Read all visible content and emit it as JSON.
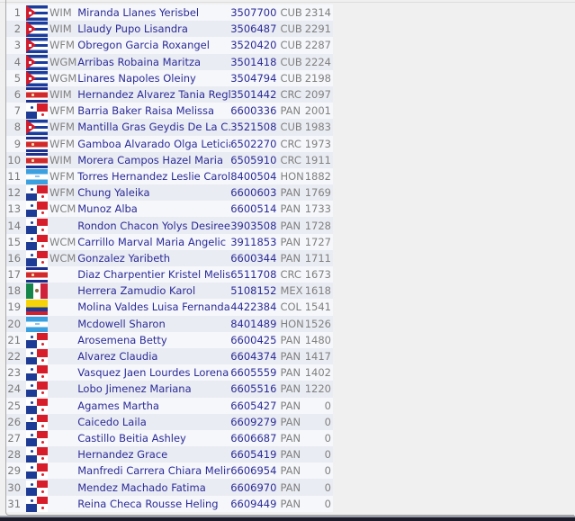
{
  "players": [
    {
      "rank": "1",
      "flag": "CUB",
      "title": "WIM",
      "name": "Miranda Llanes Yerisbel",
      "fide_id": "3507700",
      "fed": "CUB",
      "rating": "2314"
    },
    {
      "rank": "2",
      "flag": "CUB",
      "title": "WIM",
      "name": "Llaudy Pupo Lisandra",
      "fide_id": "3506487",
      "fed": "CUB",
      "rating": "2291"
    },
    {
      "rank": "3",
      "flag": "CUB",
      "title": "WFM",
      "name": "Obregon Garcia Roxangel",
      "fide_id": "3520420",
      "fed": "CUB",
      "rating": "2287"
    },
    {
      "rank": "4",
      "flag": "CUB",
      "title": "WGM",
      "name": "Arribas Robaina Maritza",
      "fide_id": "3501418",
      "fed": "CUB",
      "rating": "2224"
    },
    {
      "rank": "5",
      "flag": "CUB",
      "title": "WGM",
      "name": "Linares Napoles Oleiny",
      "fide_id": "3504794",
      "fed": "CUB",
      "rating": "2198"
    },
    {
      "rank": "6",
      "flag": "CRC",
      "title": "WIM",
      "name": "Hernandez Alvarez Tania Regla",
      "fide_id": "3501442",
      "fed": "CRC",
      "rating": "2097"
    },
    {
      "rank": "7",
      "flag": "PAN",
      "title": "WFM",
      "name": "Barria Baker Raisa Melissa",
      "fide_id": "6600336",
      "fed": "PAN",
      "rating": "2001"
    },
    {
      "rank": "8",
      "flag": "CUB",
      "title": "WFM",
      "name": "Mantilla Gras Geydis De La C.",
      "fide_id": "3521508",
      "fed": "CUB",
      "rating": "1983"
    },
    {
      "rank": "9",
      "flag": "CRC",
      "title": "WFM",
      "name": "Gamboa Alvarado Olga Leticia",
      "fide_id": "6502270",
      "fed": "CRC",
      "rating": "1973"
    },
    {
      "rank": "10",
      "flag": "CRC",
      "title": "WIM",
      "name": "Morera Campos Hazel Maria",
      "fide_id": "6505910",
      "fed": "CRC",
      "rating": "1911"
    },
    {
      "rank": "11",
      "flag": "HON",
      "title": "WFM",
      "name": "Torres Hernandez Leslie Carolin",
      "fide_id": "8400504",
      "fed": "HON",
      "rating": "1882"
    },
    {
      "rank": "12",
      "flag": "PAN",
      "title": "WFM",
      "name": "Chung Yaleika",
      "fide_id": "6600603",
      "fed": "PAN",
      "rating": "1769"
    },
    {
      "rank": "13",
      "flag": "PAN",
      "title": "WCM",
      "name": "Munoz Alba",
      "fide_id": "6600514",
      "fed": "PAN",
      "rating": "1733"
    },
    {
      "rank": "14",
      "flag": "PAN",
      "title": "",
      "name": "Rondon Chacon Yolys Desiree",
      "fide_id": "3903508",
      "fed": "PAN",
      "rating": "1728"
    },
    {
      "rank": "15",
      "flag": "PAN",
      "title": "WCM",
      "name": "Carrillo Marval Maria Angelic",
      "fide_id": "3911853",
      "fed": "PAN",
      "rating": "1727"
    },
    {
      "rank": "16",
      "flag": "PAN",
      "title": "WCM",
      "name": "Gonzalez Yaribeth",
      "fide_id": "6600344",
      "fed": "PAN",
      "rating": "1711"
    },
    {
      "rank": "17",
      "flag": "CRC",
      "title": "",
      "name": "Diaz Charpentier Kristel Meliss",
      "fide_id": "6511708",
      "fed": "CRC",
      "rating": "1673"
    },
    {
      "rank": "18",
      "flag": "MEX",
      "title": "",
      "name": "Herrera Zamudio Karol",
      "fide_id": "5108152",
      "fed": "MEX",
      "rating": "1618"
    },
    {
      "rank": "19",
      "flag": "COL",
      "title": "",
      "name": "Molina Valdes Luisa Fernanda",
      "fide_id": "4422384",
      "fed": "COL",
      "rating": "1541"
    },
    {
      "rank": "20",
      "flag": "HON",
      "title": "",
      "name": "Mcdowell Sharon",
      "fide_id": "8401489",
      "fed": "HON",
      "rating": "1526"
    },
    {
      "rank": "21",
      "flag": "PAN",
      "title": "",
      "name": "Arosemena Betty",
      "fide_id": "6600425",
      "fed": "PAN",
      "rating": "1480"
    },
    {
      "rank": "22",
      "flag": "PAN",
      "title": "",
      "name": "Alvarez Claudia",
      "fide_id": "6604374",
      "fed": "PAN",
      "rating": "1417"
    },
    {
      "rank": "23",
      "flag": "PAN",
      "title": "",
      "name": "Vasquez Jaen Lourdes Lorena",
      "fide_id": "6605559",
      "fed": "PAN",
      "rating": "1402"
    },
    {
      "rank": "24",
      "flag": "PAN",
      "title": "",
      "name": "Lobo Jimenez Mariana",
      "fide_id": "6605516",
      "fed": "PAN",
      "rating": "1220"
    },
    {
      "rank": "25",
      "flag": "PAN",
      "title": "",
      "name": "Agames Martha",
      "fide_id": "6605427",
      "fed": "PAN",
      "rating": "0"
    },
    {
      "rank": "26",
      "flag": "PAN",
      "title": "",
      "name": "Caicedo Laila",
      "fide_id": "6609279",
      "fed": "PAN",
      "rating": "0"
    },
    {
      "rank": "27",
      "flag": "PAN",
      "title": "",
      "name": "Castillo Beitia Ashley",
      "fide_id": "6606687",
      "fed": "PAN",
      "rating": "0"
    },
    {
      "rank": "28",
      "flag": "PAN",
      "title": "",
      "name": "Hernandez Grace",
      "fide_id": "6605419",
      "fed": "PAN",
      "rating": "0"
    },
    {
      "rank": "29",
      "flag": "PAN",
      "title": "",
      "name": "Manfredi Carrera Chiara Melina",
      "fide_id": "6606954",
      "fed": "PAN",
      "rating": "0"
    },
    {
      "rank": "30",
      "flag": "PAN",
      "title": "",
      "name": "Mendez Machado Fatima",
      "fide_id": "6606970",
      "fed": "PAN",
      "rating": "0"
    },
    {
      "rank": "31",
      "flag": "PAN",
      "title": "",
      "name": "Reina Checa Rousse Heling",
      "fide_id": "6609449",
      "fed": "PAN",
      "rating": "0"
    }
  ],
  "flag_icons": {
    "CUB": "cuba-flag-icon",
    "CRC": "costa-rica-flag-icon",
    "PAN": "panama-flag-icon",
    "HON": "honduras-flag-icon",
    "MEX": "mexico-flag-icon",
    "COL": "colombia-flag-icon"
  },
  "colors": {
    "link_text": "#2b2b96",
    "muted_text": "#808080",
    "row_odd": "#f6f7fb",
    "row_even": "#eaecf3",
    "page_bg": "#f0f0f0"
  }
}
